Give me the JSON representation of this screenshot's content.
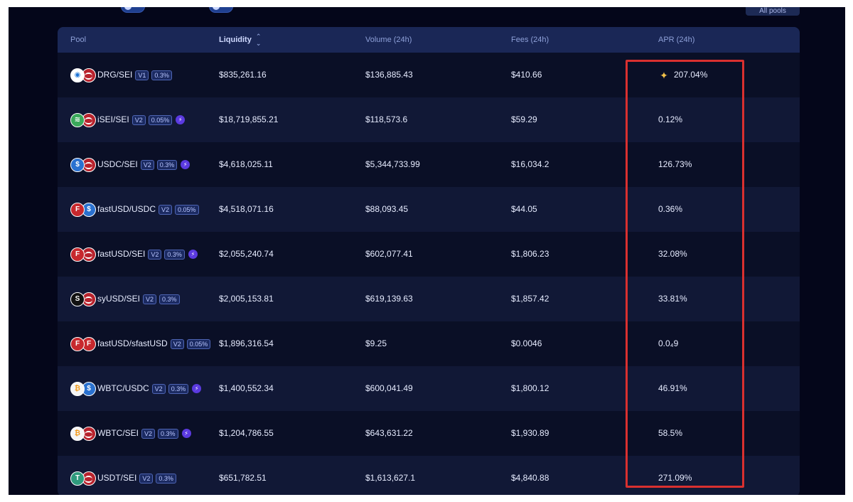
{
  "topbar": {
    "label_1": "",
    "label_2": "",
    "all_pools_button": "All pools"
  },
  "table": {
    "headers": {
      "pool": "Pool",
      "liquidity": "Liquidity",
      "volume": "Volume (24h)",
      "fees": "Fees (24h)",
      "apr": "APR (24h)"
    },
    "sort_icon": "sort-updown-icon",
    "rows": [
      {
        "pool": "DRG/SEI",
        "version": "V1",
        "fee_tier": "0.3%",
        "token_icons": [
          "drg-token-icon",
          "sei-token-icon"
        ],
        "boosted": false,
        "liquidity": "$835,261.16",
        "volume": "$136,885.43",
        "fees": "$410.66",
        "apr": "207.04%",
        "apr_icon": "spark-icon"
      },
      {
        "pool": "iSEI/SEI",
        "version": "V2",
        "fee_tier": "0.05%",
        "token_icons": [
          "isei-token-icon",
          "sei-token-icon"
        ],
        "boosted": true,
        "liquidity": "$18,719,855.21",
        "volume": "$118,573.6",
        "fees": "$59.29",
        "apr": "0.12%"
      },
      {
        "pool": "USDC/SEI",
        "version": "V2",
        "fee_tier": "0.3%",
        "token_icons": [
          "usdc-token-icon",
          "sei-token-icon"
        ],
        "boosted": true,
        "liquidity": "$4,618,025.11",
        "volume": "$5,344,733.99",
        "fees": "$16,034.2",
        "apr": "126.73%"
      },
      {
        "pool": "fastUSD/USDC",
        "version": "V2",
        "fee_tier": "0.05%",
        "token_icons": [
          "fastusd-token-icon",
          "usdc-token-icon"
        ],
        "boosted": false,
        "liquidity": "$4,518,071.16",
        "volume": "$88,093.45",
        "fees": "$44.05",
        "apr": "0.36%"
      },
      {
        "pool": "fastUSD/SEI",
        "version": "V2",
        "fee_tier": "0.3%",
        "token_icons": [
          "fastusd-token-icon",
          "sei-token-icon"
        ],
        "boosted": true,
        "liquidity": "$2,055,240.74",
        "volume": "$602,077.41",
        "fees": "$1,806.23",
        "apr": "32.08%"
      },
      {
        "pool": "syUSD/SEI",
        "version": "V2",
        "fee_tier": "0.3%",
        "token_icons": [
          "syusd-token-icon",
          "sei-token-icon"
        ],
        "boosted": false,
        "liquidity": "$2,005,153.81",
        "volume": "$619,139.63",
        "fees": "$1,857.42",
        "apr": "33.81%"
      },
      {
        "pool": "fastUSD/sfastUSD",
        "version": "V2",
        "fee_tier": "0.05%",
        "token_icons": [
          "fastusd-token-icon",
          "sfastusd-token-icon"
        ],
        "boosted": false,
        "liquidity": "$1,896,316.54",
        "volume": "$9.25",
        "fees": "$0.0046",
        "apr": "0.0₄9"
      },
      {
        "pool": "WBTC/USDC",
        "version": "V2",
        "fee_tier": "0.3%",
        "token_icons": [
          "wbtc-token-icon",
          "usdc-token-icon"
        ],
        "boosted": true,
        "liquidity": "$1,400,552.34",
        "volume": "$600,041.49",
        "fees": "$1,800.12",
        "apr": "46.91%"
      },
      {
        "pool": "WBTC/SEI",
        "version": "V2",
        "fee_tier": "0.3%",
        "token_icons": [
          "wbtc-token-icon",
          "sei-token-icon"
        ],
        "boosted": true,
        "liquidity": "$1,204,786.55",
        "volume": "$643,631.22",
        "fees": "$1,930.89",
        "apr": "58.5%"
      },
      {
        "pool": "USDT/SEI",
        "version": "V2",
        "fee_tier": "0.3%",
        "token_icons": [
          "usdt-token-icon",
          "sei-token-icon"
        ],
        "boosted": false,
        "liquidity": "$651,782.51",
        "volume": "$1,613,627.1",
        "fees": "$4,840.88",
        "apr": "271.09%"
      }
    ]
  },
  "colors": {
    "background": "#04061a",
    "header_bg": "#1a2756",
    "row_odd": "#0a0f26",
    "row_even": "#111836",
    "highlight_border": "#d9302f",
    "badge_border": "#4f66b5"
  }
}
